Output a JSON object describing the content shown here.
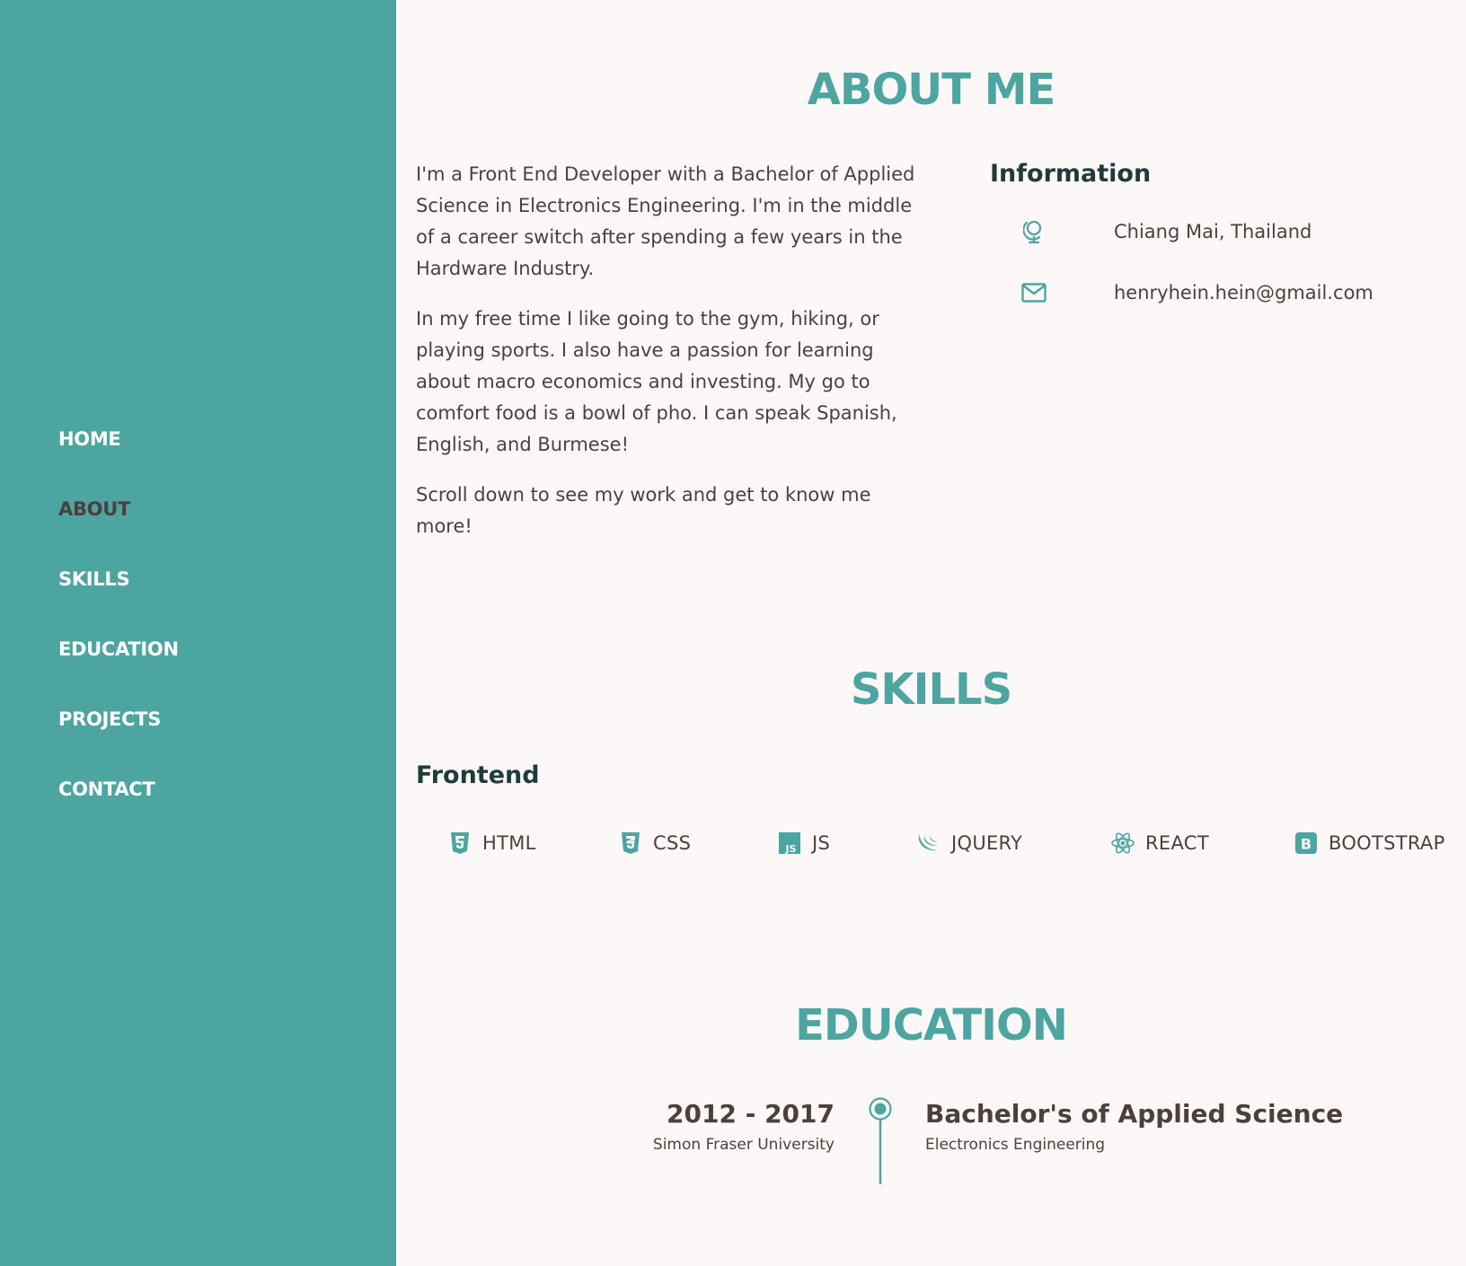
{
  "colors": {
    "accent": "#4ca5a1",
    "background": "#fcf8f7",
    "text": "#4d3f3c",
    "heading_dark": "#1e3c3c",
    "nav_text": "#ffffff",
    "nav_active": "#4d3f3c"
  },
  "sidebar": {
    "nav": [
      {
        "label": "HOME",
        "active": false
      },
      {
        "label": "ABOUT",
        "active": true
      },
      {
        "label": "SKILLS",
        "active": false
      },
      {
        "label": "EDUCATION",
        "active": false
      },
      {
        "label": "PROJECTS",
        "active": false
      },
      {
        "label": "CONTACT",
        "active": false
      }
    ]
  },
  "about": {
    "title": "ABOUT ME",
    "paragraphs": [
      "I'm a Front End Developer with a Bachelor of Applied Science in Electronics Engineering. I'm in the middle of a career switch after spending a few years in the Hardware Industry.",
      "In my free time I like going to the gym, hiking, or playing sports. I also have a passion for learning about macro economics and investing. My go to comfort food is a bowl of pho. I can speak Spanish, English, and Burmese!",
      "Scroll down to see my work and get to know me more!"
    ],
    "info": {
      "title": "Information",
      "location": {
        "icon": "globe-icon",
        "text": "Chiang Mai, Thailand"
      },
      "email": {
        "icon": "envelope-icon",
        "text": "henryhein.hein@gmail.com"
      }
    }
  },
  "skills": {
    "title": "SKILLS",
    "frontend": {
      "title": "Frontend",
      "items": [
        {
          "label": "HTML",
          "icon": "html5-icon"
        },
        {
          "label": "CSS",
          "icon": "css3-icon"
        },
        {
          "label": "JS",
          "icon": "js-icon"
        },
        {
          "label": "JQUERY",
          "icon": "jquery-icon"
        },
        {
          "label": "REACT",
          "icon": "react-icon"
        },
        {
          "label": "BOOTSTRAP",
          "icon": "bootstrap-icon"
        }
      ]
    }
  },
  "education": {
    "title": "EDUCATION",
    "entries": [
      {
        "years": "2012 - 2017",
        "school": "Simon Fraser University",
        "degree": "Bachelor's of Applied Science",
        "field": "Electronics Engineering"
      }
    ]
  }
}
